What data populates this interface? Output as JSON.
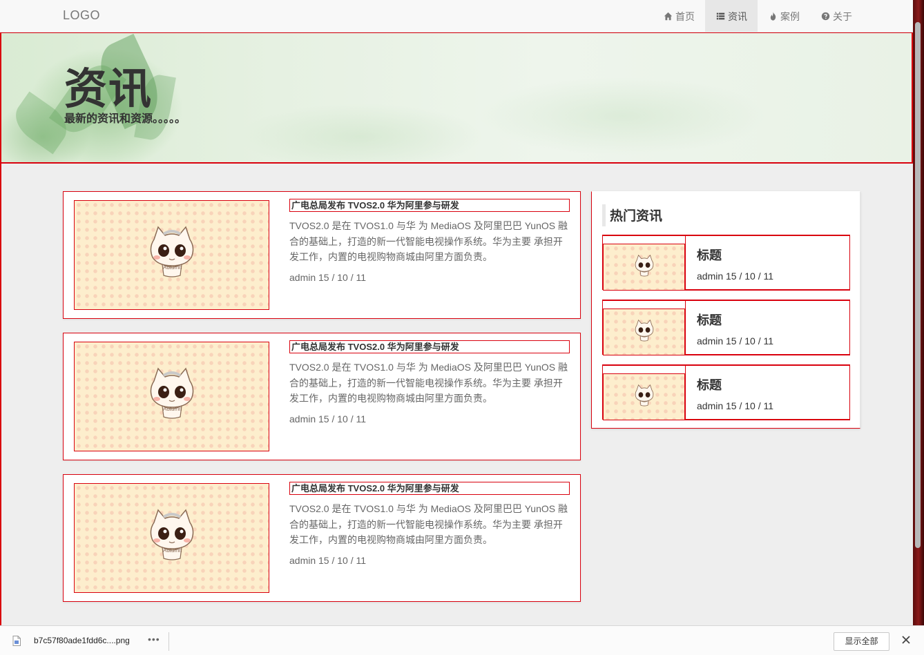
{
  "navbar": {
    "logo": "LOGO",
    "items": [
      {
        "label": "首页",
        "icon": "home-icon",
        "active": false
      },
      {
        "label": "资讯",
        "icon": "list-icon",
        "active": true
      },
      {
        "label": "案例",
        "icon": "fire-icon",
        "active": false
      },
      {
        "label": "关于",
        "icon": "question-circle-icon",
        "active": false
      }
    ]
  },
  "banner": {
    "title": "资讯",
    "subtitle": "最新的资讯和资源。。。。。"
  },
  "articles": [
    {
      "title": "广电总局发布 TVOS2.0 华为阿里参与研发",
      "description": "TVOS2.0 是在 TVOS1.0 与华 为 MediaOS 及阿里巴巴 YunOS 融合的基础上，打造的新一代智能电视操作系统。华为主要 承担开发工作，内置的电视购物商城由阿里方面负责。",
      "meta": "admin 15 / 10 / 11",
      "image_caption": "Autumn"
    },
    {
      "title": "广电总局发布 TVOS2.0 华为阿里参与研发",
      "description": "TVOS2.0 是在 TVOS1.0 与华 为 MediaOS 及阿里巴巴 YunOS 融合的基础上，打造的新一代智能电视操作系统。华为主要 承担开发工作，内置的电视购物商城由阿里方面负责。",
      "meta": "admin 15 / 10 / 11",
      "image_caption": "Autumn"
    },
    {
      "title": "广电总局发布 TVOS2.0 华为阿里参与研发",
      "description": "TVOS2.0 是在 TVOS1.0 与华 为 MediaOS 及阿里巴巴 YunOS 融合的基础上，打造的新一代智能电视操作系统。华为主要 承担开发工作，内置的电视购物商城由阿里方面负责。",
      "meta": "admin 15 / 10 / 11",
      "image_caption": "Autumn"
    }
  ],
  "sidebar": {
    "heading": "热门资讯",
    "items": [
      {
        "title": "标题",
        "meta": "admin 15 / 10 / 11"
      },
      {
        "title": "标题",
        "meta": "admin 15 / 10 / 11"
      },
      {
        "title": "标题",
        "meta": "admin 15 / 10 / 11"
      }
    ]
  },
  "download_bar": {
    "file_name": "b7c57f80ade1fdd6c....png",
    "more": "•••",
    "show_all": "显示全部"
  },
  "colors": {
    "accent_border": "#d9000d",
    "page_background": "#eeeeee",
    "navbar_background": "#f8f8f8"
  }
}
